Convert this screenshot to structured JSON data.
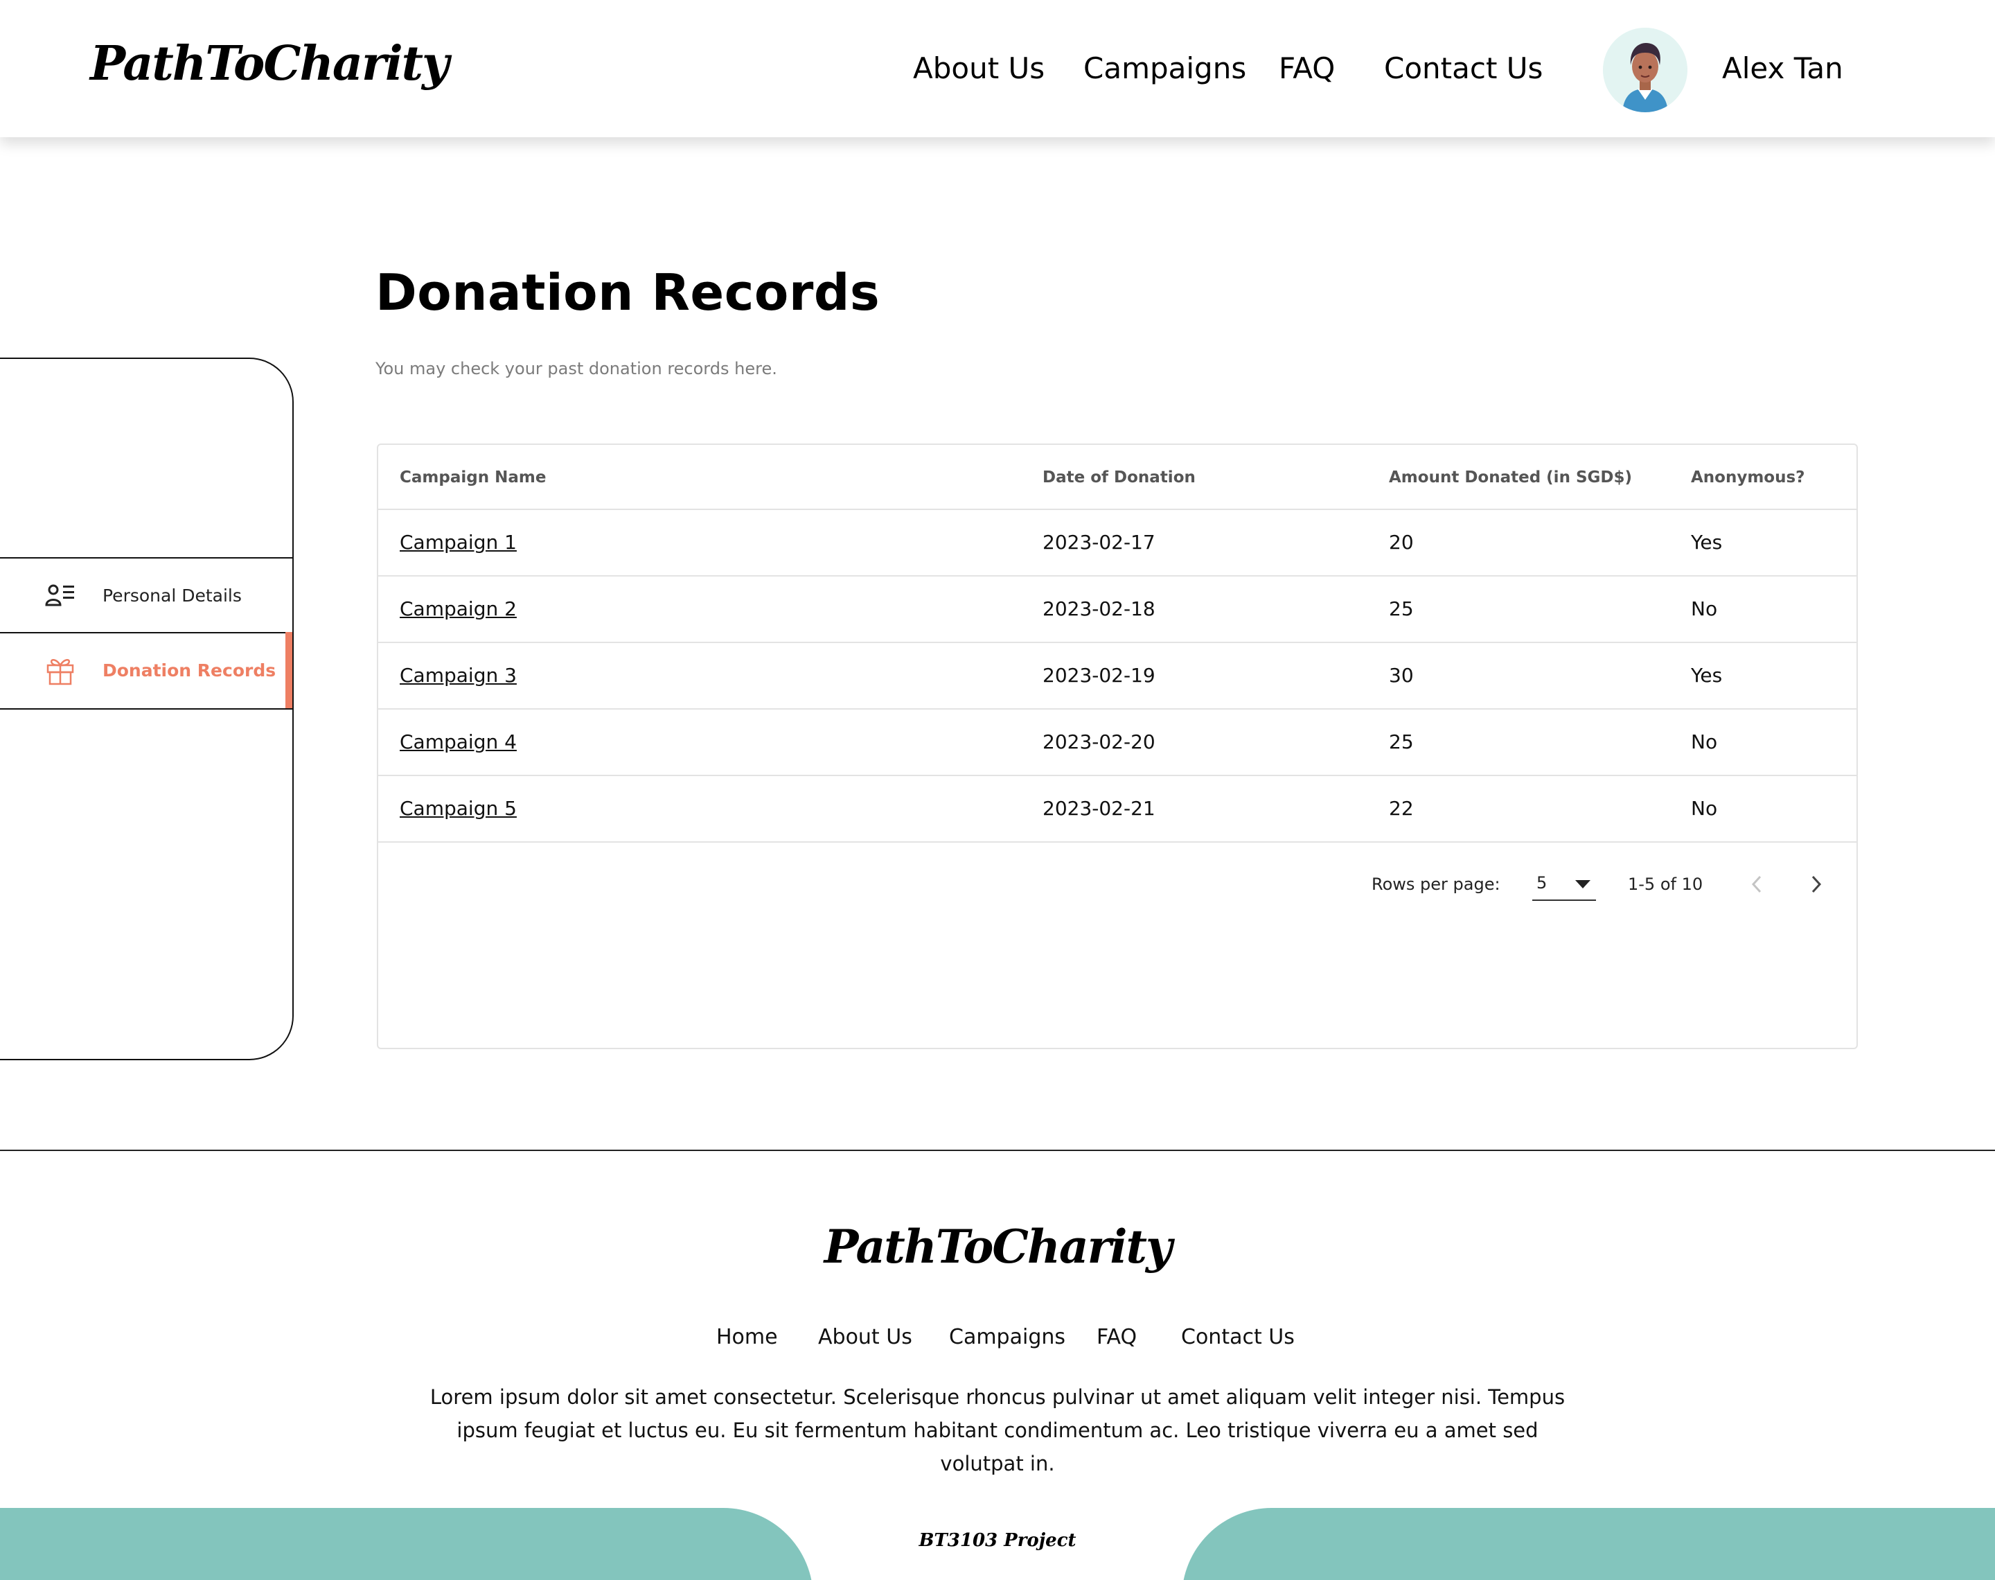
{
  "header": {
    "logo": "PathToCharity",
    "nav": [
      "About Us",
      "Campaigns",
      "FAQ",
      "Contact Us"
    ],
    "user_name": "Alex Tan"
  },
  "sidebar": {
    "items": [
      {
        "label": "Personal Details",
        "icon": "person-list-icon",
        "active": false
      },
      {
        "label": "Donation Records",
        "icon": "gift-icon",
        "active": true
      }
    ]
  },
  "main": {
    "title": "Donation Records",
    "subtitle": "You may check your past donation records here."
  },
  "table": {
    "columns": [
      "Campaign Name",
      "Date of Donation",
      "Amount Donated (in SGD$)",
      "Anonymous?"
    ],
    "rows": [
      {
        "campaign": "Campaign 1",
        "date": "2023-02-17",
        "amount": "20",
        "anonymous": "Yes"
      },
      {
        "campaign": "Campaign 2",
        "date": "2023-02-18",
        "amount": "25",
        "anonymous": "No"
      },
      {
        "campaign": "Campaign 3",
        "date": "2023-02-19",
        "amount": "30",
        "anonymous": "Yes"
      },
      {
        "campaign": "Campaign 4",
        "date": "2023-02-20",
        "amount": "25",
        "anonymous": "No"
      },
      {
        "campaign": "Campaign 5",
        "date": "2023-02-21",
        "amount": "22",
        "anonymous": "No"
      }
    ],
    "pagination": {
      "rows_per_page_label": "Rows per page:",
      "rows_per_page": "5",
      "range": "1-5 of 10"
    }
  },
  "footer": {
    "logo": "PathToCharity",
    "nav": [
      "Home",
      "About Us",
      "Campaigns",
      "FAQ",
      "Contact Us"
    ],
    "text": "Lorem ipsum dolor sit amet consectetur. Scelerisque rhoncus pulvinar ut amet aliquam velit integer nisi. Tempus ipsum feugiat et luctus eu. Eu sit fermentum habitant condimentum ac. Leo tristique viverra eu a amet sed volutpat in.",
    "project": "BT3103 Project"
  },
  "colors": {
    "accent": "#ee7f63",
    "teal": "#83c5bd",
    "avatar_bg": "#e3f4f2",
    "border": "#e3e3e3"
  }
}
